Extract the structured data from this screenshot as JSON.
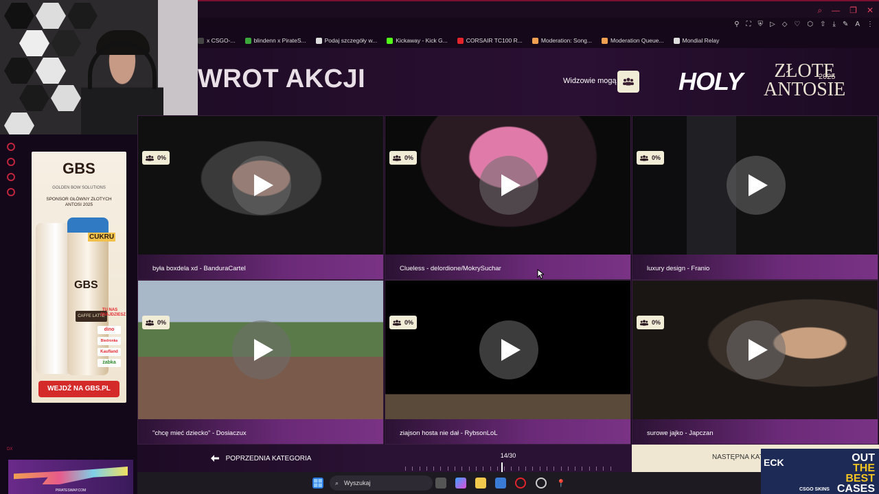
{
  "browser": {
    "bookmarks": [
      {
        "label": "x CSGO-...",
        "color": "#444444"
      },
      {
        "label": "blindenn x PirateS...",
        "color": "#3aa83a"
      },
      {
        "label": "Podaj szczegóły w...",
        "color": "#dddddd"
      },
      {
        "label": "Kickaway - Kick G...",
        "color": "#53fc18"
      },
      {
        "label": "CORSAIR TC100 R...",
        "color": "#e3242b"
      },
      {
        "label": "Moderation: Song...",
        "color": "#f0a050"
      },
      {
        "label": "Moderation Queue...",
        "color": "#f0a050"
      },
      {
        "label": "Mondial Relay",
        "color": "#dddddd"
      }
    ]
  },
  "header": {
    "title": "WROT AKCJI",
    "viewers_label": "Widzowie mogą",
    "logo_holy": "HOLY",
    "logo_zlote": "ZŁOTE",
    "logo_antosie": "ANTOSIE",
    "logo_year": "2025"
  },
  "ad": {
    "logo": "GBS",
    "subtitle": "GOLDEN BOW SOLUTIONS",
    "sponsor": "SPONSOR GŁÓWNY ZŁOTYCH ANTOSI 2025",
    "can_logo": "GBS",
    "cukru": "CUKRU",
    "flavor": "CAFFE LATTE",
    "tunas": "TU NAS ZNAJDZIESZ",
    "stores": [
      "dino",
      "Biedronka",
      "Kaufland",
      "żabka"
    ],
    "cta": "WEJDŹ NA GBS.PL"
  },
  "clips": [
    {
      "caption": "była boxdela xd - BanduraCartel",
      "percent": "0%"
    },
    {
      "caption": "Clueless - delordione/MokrySuchar",
      "percent": "0%"
    },
    {
      "caption": "luxury design - Franio",
      "percent": "0%"
    },
    {
      "caption": "\"chcę mieć dziecko\" - Dosiaczux",
      "percent": "0%"
    },
    {
      "caption": "ziajson hosta nie dał - RybsonLoL",
      "percent": "0%"
    },
    {
      "caption": "surowe jajko - Japczan",
      "percent": "0%"
    }
  ],
  "navigation": {
    "prev_label": "POPRZEDNIA KATEGORIA",
    "pager": "14/30",
    "pager_progress": 0.467,
    "next_label": "NASTĘPNA KAT"
  },
  "csgo_ad": {
    "eck": "ECK",
    "line1": "OUT",
    "line2": "THE BEST",
    "line3": "CASES",
    "brand": "CSGO SKINS"
  },
  "pirate": {
    "url": "PIRATESWAP.COM"
  },
  "taskbar": {
    "search_placeholder": "Wyszukaj"
  },
  "left_strip": "DX"
}
